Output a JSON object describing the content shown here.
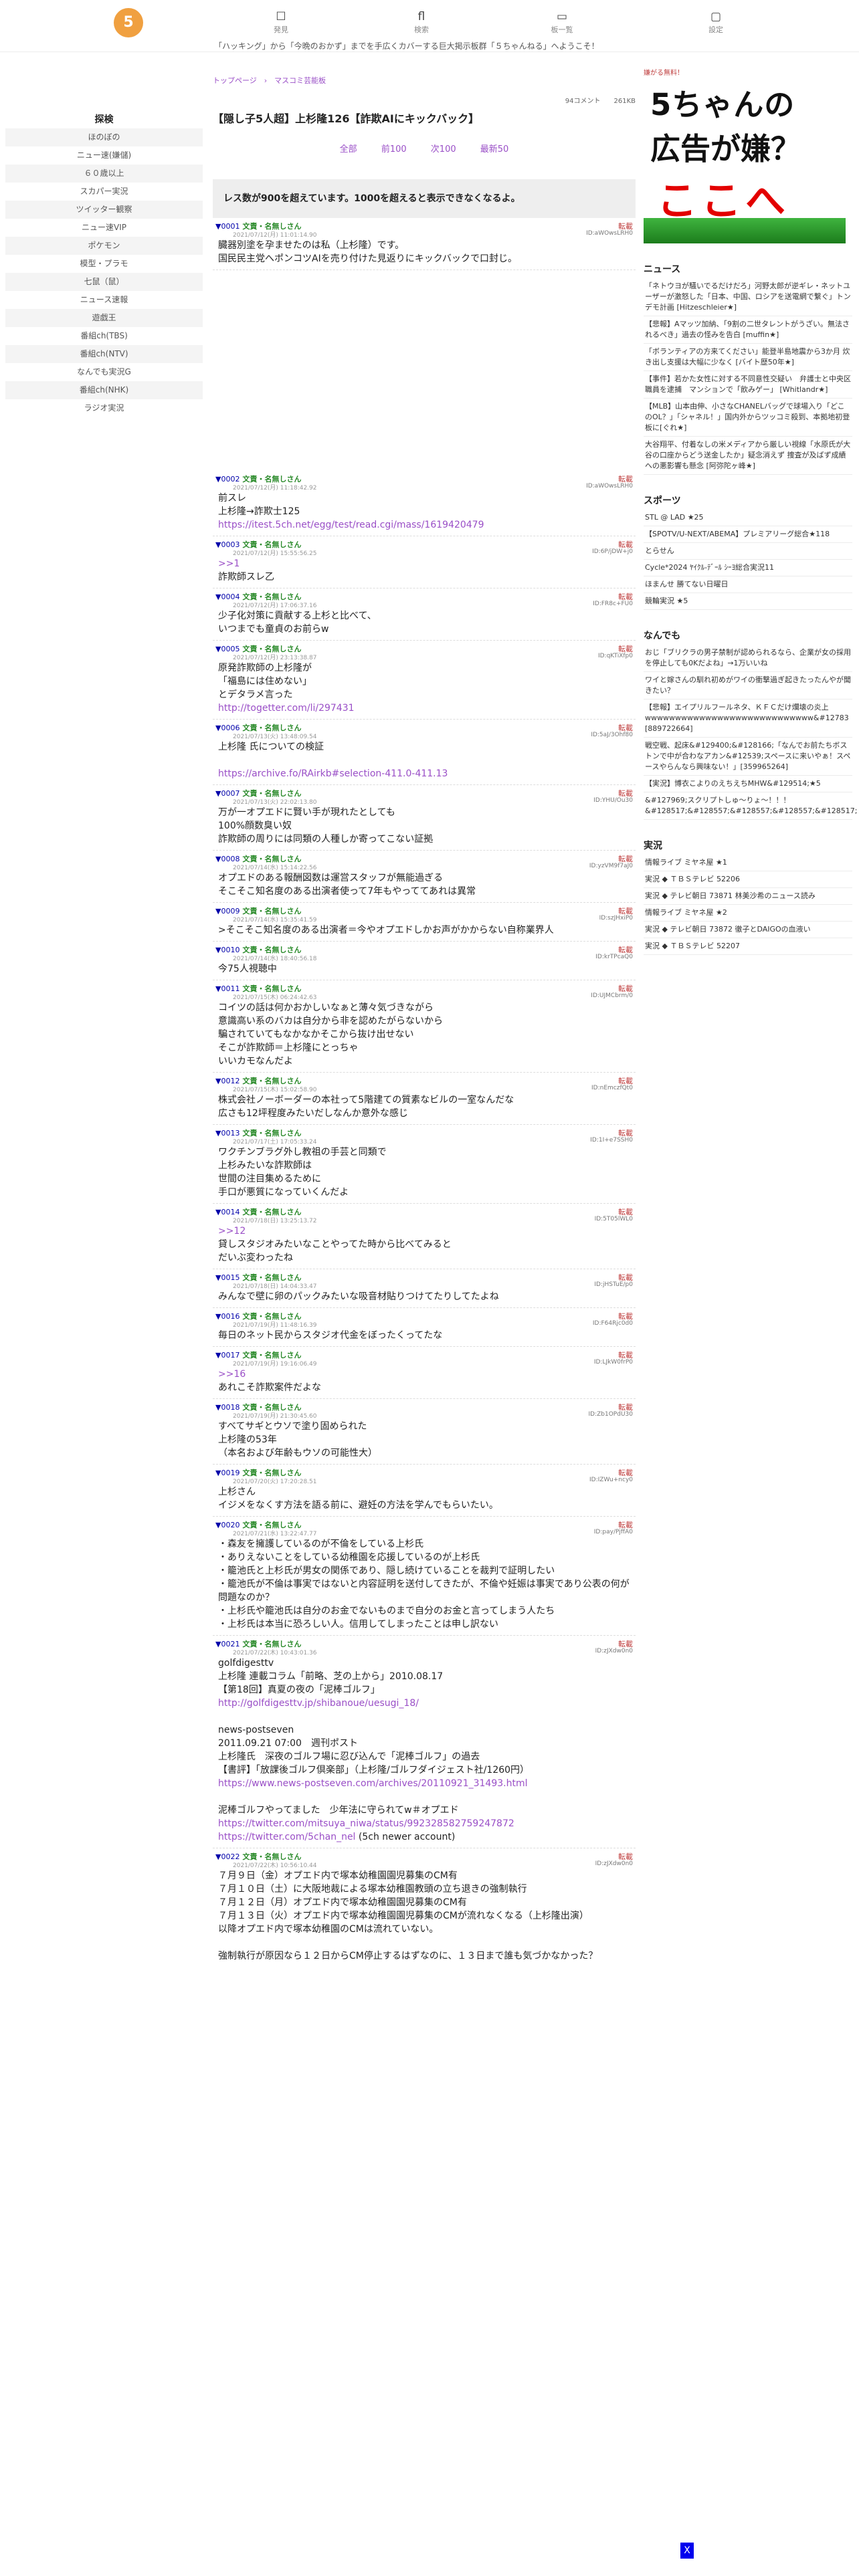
{
  "header": {
    "logo": "5",
    "nav": [
      {
        "icon": "☐",
        "label": "発見"
      },
      {
        "icon": "fl",
        "label": "検索"
      },
      {
        "icon": "▭",
        "label": "板一覧"
      },
      {
        "icon": "▢",
        "label": "設定"
      }
    ],
    "ticker": "「ハッキング」から「今晩のおかず」までを手広くカバーする巨大掲示板群「５ちゃんねる」へようこそ！"
  },
  "left": {
    "title": "探検",
    "links": [
      "ほのぼの",
      "ニュー速(嫌儲)",
      "６０歳以上",
      "スカパー実況",
      "ツイッター観察",
      "ニュー速VIP",
      "ポケモン",
      "模型・プラモ",
      "七鼠（鼠）",
      "ニュース速報",
      "遊戯王",
      "番組ch(TBS)",
      "番組ch(NTV)",
      "なんでも実況G",
      "番組ch(NHK)",
      "ラジオ実況"
    ]
  },
  "main": {
    "breadcrumb": "トップページ　›　マスコミ芸能板",
    "meta": "94コメント　　261KB",
    "title": "【隠し子5人超】上杉隆126【詐欺AIにキックバック】",
    "pager": [
      "全部",
      "前100",
      "次100",
      "最新50"
    ],
    "warning": "レス数が900を超えています。1000を超えると表示できなくなるよ。",
    "posts": [
      {
        "no": "▼0001",
        "name": "文責・名無しさん",
        "reply": "転載",
        "date": "2021/07/12(月) 11:01:14.90",
        "id": "ID:aWOwsLRH0",
        "body": "臓器別塗を孕ませたのは私（上杉隆）です。\n国民民主党へポンコツAIを売り付けた見返りにキックバックで口封じ。"
      },
      {
        "no": "▼0002",
        "name": "文責・名無しさん",
        "reply": "転載",
        "date": "2021/07/12(月) 11:18:42.92",
        "id": "ID:aWOwsLRH0",
        "body": "前スレ\n上杉隆→詐欺士125",
        "link": "https://itest.5ch.net/egg/test/read.cgi/mass/1619420479"
      },
      {
        "no": "▼0003",
        "name": "文責・名無しさん",
        "reply": "転載",
        "date": "2021/07/12(月) 15:55:56.25",
        "id": "ID:6P/jDW+j0",
        "body": "詐欺師スレ乙",
        "quote": ">>1"
      },
      {
        "no": "▼0004",
        "name": "文責・名無しさん",
        "reply": "転載",
        "date": "2021/07/12(月) 17:06:37.16",
        "id": "ID:FR8c+FU0",
        "body": "少子化対策に貢献する上杉と比べて、\nいつまでも童貞のお前らw"
      },
      {
        "no": "▼0005",
        "name": "文責・名無しさん",
        "reply": "転載",
        "date": "2021/07/12(月) 23:13:38.87",
        "id": "ID:qKTiXfp0",
        "body": "原発詐欺師の上杉隆が\n「福島には住めない」\nとデタラメ言った",
        "link": "http://togetter.com/li/297431"
      },
      {
        "no": "▼0006",
        "name": "文責・名無しさん",
        "reply": "転載",
        "date": "2021/07/13(火) 13:48:09.54",
        "id": "ID:5aJ/3Ohf80",
        "body": "上杉隆 氏についての検証\n",
        "link": "https://archive.fo/RAirkb#selection-411.0-411.13"
      },
      {
        "no": "▼0007",
        "name": "文責・名無しさん",
        "reply": "転載",
        "date": "2021/07/13(火) 22:02:13.80",
        "id": "ID:YHU/Ou30",
        "body": "万が一オプエドに賢い手が現れたとしても\n100%顔数臭い奴\n詐欺師の周りには同類の人種しか寄ってこない証拠"
      },
      {
        "no": "▼0008",
        "name": "文責・名無しさん",
        "reply": "転載",
        "date": "2021/07/14(水) 15:14:22.56",
        "id": "ID:yzVM9f7aJ0",
        "body": "オプエドのある報酬図数は運営スタッフが無能過ぎる\nそこそこ知名度のある出演者使って7年もやっててあれは異常"
      },
      {
        "no": "▼0009",
        "name": "文責・名無しさん",
        "reply": "転載",
        "date": "2021/07/14(水) 15:35:41.59",
        "id": "ID:szJHxiP0",
        "body": ">そこそこ知名度のある出演者＝今やオプエドしかお声がかからない自称業界人"
      },
      {
        "no": "▼0010",
        "name": "文責・名無しさん",
        "reply": "転載",
        "date": "2021/07/14(水) 18:40:56.18",
        "id": "ID:krTPcaQ0",
        "body": "今75人視聴中"
      },
      {
        "no": "▼0011",
        "name": "文責・名無しさん",
        "reply": "転載",
        "date": "2021/07/15(木) 06:24:42.63",
        "id": "ID:UJMCbrm/0",
        "body": "コイツの話は何かおかしいなぁと薄々気づきながら\n意識高い系のバカは自分から非を認めたがらないから\n騙されていてもなかなかそこから抜け出せない\nそこが詐欺師＝上杉隆にとっちゃ\nいいカモなんだよ"
      },
      {
        "no": "▼0012",
        "name": "文責・名無しさん",
        "reply": "転載",
        "date": "2021/07/15(木) 15:02:58.90",
        "id": "ID:nEmczfQt0",
        "body": "株式会社ノーボーダーの本社って5階建ての質素なビルの一室なんだな\n広さも12坪程度みたいだしなんか意外な感じ"
      },
      {
        "no": "▼0013",
        "name": "文責・名無しさん",
        "reply": "転載",
        "date": "2021/07/17(土) 17:05:33.24",
        "id": "ID:1I+e7SSH0",
        "body": "ワクチンブラグ外し教祖の手芸と同類で\n上杉みたいな詐欺師は\n世間の注目集めるために\n手口が悪質になっていくんだよ"
      },
      {
        "no": "▼0014",
        "name": "文責・名無しさん",
        "reply": "転載",
        "date": "2021/07/18(日) 13:25:13.72",
        "id": "ID:5T05lWL0",
        "body": "貸しスタジオみたいなことやってた時から比べてみると\nだいぶ変わったね",
        "quote": ">>12"
      },
      {
        "no": "▼0015",
        "name": "文責・名無しさん",
        "reply": "転載",
        "date": "2021/07/18(日) 14:04:33.47",
        "id": "ID:jHSTuE/p0",
        "body": "みんなで壁に卵のパックみたいな吸音材貼りつけてたりしてたよね"
      },
      {
        "no": "▼0016",
        "name": "文責・名無しさん",
        "reply": "転載",
        "date": "2021/07/19(月) 11:48:16.39",
        "id": "ID:F64Rjc0d0",
        "body": "毎日のネット民からスタジオ代金をぼったくってたな"
      },
      {
        "no": "▼0017",
        "name": "文責・名無しさん",
        "reply": "転載",
        "date": "2021/07/19(月) 19:16:06.49",
        "id": "ID:LJkW0frP0",
        "body": "あれこそ詐欺案件だよな",
        "quote": ">>16"
      },
      {
        "no": "▼0018",
        "name": "文責・名無しさん",
        "reply": "転載",
        "date": "2021/07/19(月) 21:30:45.60",
        "id": "ID:Zb1OPdU30",
        "body": "すべてサギとウソで塗り固められた\n上杉隆の53年\n（本名および年齢もウソの可能性大）"
      },
      {
        "no": "▼0019",
        "name": "文責・名無しさん",
        "reply": "転載",
        "date": "2021/07/20(火) 17:20:28.51",
        "id": "ID:IZWu+ncy0",
        "body": "上杉さん\nイジメをなくす方法を語る前に、避妊の方法を学んでもらいたい。"
      },
      {
        "no": "▼0020",
        "name": "文責・名無しさん",
        "reply": "転載",
        "date": "2021/07/21(水) 13:22:47.77",
        "id": "ID:pay/PjffA0",
        "body": "・森友を擁護しているのが不倫をしている上杉氏\n・ありえないことをしている幼稚園を応援しているのが上杉氏\n・籠池氏と上杉氏が男女の関係であり、隠し続けていることを裁判で証明したい\n・籠池氏が不倫は事実ではないと内容証明を送付してきたが、不倫や妊娠は事実であり公表の何が問題なのか？\n・上杉氏や籠池氏は自分のお金でないものまで自分のお金と言ってしまう人たち\n・上杉氏は本当に恐ろしい人。信用してしまったことは申し訳ない"
      },
      {
        "no": "▼0021",
        "name": "文責・名無しさん",
        "reply": "転載",
        "date": "2021/07/22(木) 10:43:01.36",
        "id": "ID:zJXdw0n0",
        "body": "golfdigesttv\n上杉隆 連載コラム「前略、芝の上から」2010.08.17\n【第18回】真夏の夜の「泥棒ゴルフ」",
        "link": "http://golfdigesttv.jp/shibanoue/uesugi_18/",
        "body2": "news-postseven\n2011.09.21 07:00　週刊ポスト\n上杉隆氏　深夜のゴルフ場に忍び込んで「泥棒ゴルフ」の過去\n【書評】「放課後ゴルフ倶楽部」（上杉隆/ゴルフダイジェスト社/1260円）",
        "link2": "https://www.news-postseven.com/archives/20110921_31493.html",
        "body3": "泥棒ゴルフやってました　少年法に守られてw＃オプエド",
        "link3": "https://twitter.com/mitsuya_niwa/status/992328582759247872",
        "link4": "https://twitter.com/5chan_nel",
        "link4note": " (5ch newer account)"
      },
      {
        "no": "▼0022",
        "name": "文責・名無しさん",
        "reply": "転載",
        "date": "2021/07/22(木) 10:56:10.44",
        "id": "ID:zJXdw0n0",
        "body": "７月９日（金）オプエド内で塚本幼稚園園児募集のCM有\n７月１０日（土）に大阪地裁による塚本幼稚園教頭の立ち退きの強制執行\n７月１２日（月）オプエド内で塚本幼稚園園児募集のCM有\n７月１３日（火）オプエド内で塚本幼稚園園児募集のCMが流れなくなる（上杉隆出演）\n以降オプエド内で塚本幼稚園のCMは流れていない。\n\n強制執行が原因なら１２日からCM停止するはずなのに、１３日まで誰も気づかなかった？"
      }
    ]
  },
  "right": {
    "ad_tag": "嫌がる無料！",
    "ad_lines": [
      "5ちゃんの",
      "広告が嫌？",
      "ここへ"
    ],
    "sections": [
      {
        "title": "ニュース",
        "items": [
          "「ネトウヨが騒いでるだけだろ」河野太郎が逆ギレ・ネットユーザーが激怒した「日本、中国、ロシアを送電網で繋ぐ」トンデモ計画 [Hitzeschleier★]",
          "【悲報】Aマッツ加納、「9割の二世タレントがうざい。無法されるべき」過去の怪みを告白 [muffin★]",
          "「ボランティアの方来てください」能登半島地震から3か月 炊き出し支援は大幅に少なく [バイト歴50年★]",
          "【事件】若かた女性に対する不同意性交疑い　弁護士と中央区職員を逮捕　マンションで「飲みゲー」 [Whitlandr★]",
          "【MLB】山本由伸、小さなCHANELバッグで球場入り「どこのOL？」「シャネル！」国内外からツッコミ殺到、本拠地初登板に[ぐれ★]",
          "大谷翔平、付着なしの米メディアから厳しい視線「水原氏が大谷の口座からどう送金したか」疑念消えず 捜査が及ばず成績への悪影響も懸念 [阿弥陀ヶ峰★]"
        ]
      },
      {
        "title": "スポーツ",
        "items": [
          "STL @ LAD ★25",
          "【SPOTV/U-NEXT/ABEMA】プレミアリーグ総合★118",
          "とらせん",
          "Cycle*2024 ﾔｲｸﾙ-ﾃﾞｰﾙ ｼｰﾖ総合実況11",
          "ほまんせ 勝てない日曜日",
          "競輪実況 ★5"
        ]
      },
      {
        "title": "なんでも",
        "items": [
          "おじ「ブリクラの男子禁制が認められるなら、企業が女の採用を停止しても0Kだよね」→1万いいね",
          "ワイと嫁さんの馴れ初めがワイの衝撃過ぎ起きたったんやが聞きたい？",
          "【悲報】エイプリルフールネタ、ＫＦＣだけ爛壊の炎上\nwwwwwwwwwwwwwwwwwwwwwwwwwwww&#12783 [889722664]",
          "戦空戦、起床&#129400;&#128166;「なんでお前たちボストンで中が合わなアカン&#12539;スペースに来いやぁ！スペースやらんなら興味ない！」[359965264]",
          "【実況】博衣こよりのえちえちMHW&#129514;★5",
          "&#127969;スクリプトしゅ～りょ～！！！&#128517;&#128557;&#128557;&#128557;&#128517;"
        ]
      },
      {
        "title": "実況",
        "items": [
          {
            "t": "情報ライブ ミヤネ屋 ★1"
          },
          {
            "t": "実況 ◆ ＴＢＳテレビ 52206"
          },
          {
            "t": "実況 ◆ テレビ朝日 73871 林美沙希のニュース読み"
          },
          {
            "t": "情報ライブ ミヤネ屋 ★2"
          },
          {
            "t": "実況 ◆ テレビ朝日 73872 徹子とDAIGOの血液い"
          },
          {
            "t": "実況 ◆ ＴＢＳテレビ 52207"
          }
        ]
      }
    ],
    "bottom_ad": "X"
  }
}
